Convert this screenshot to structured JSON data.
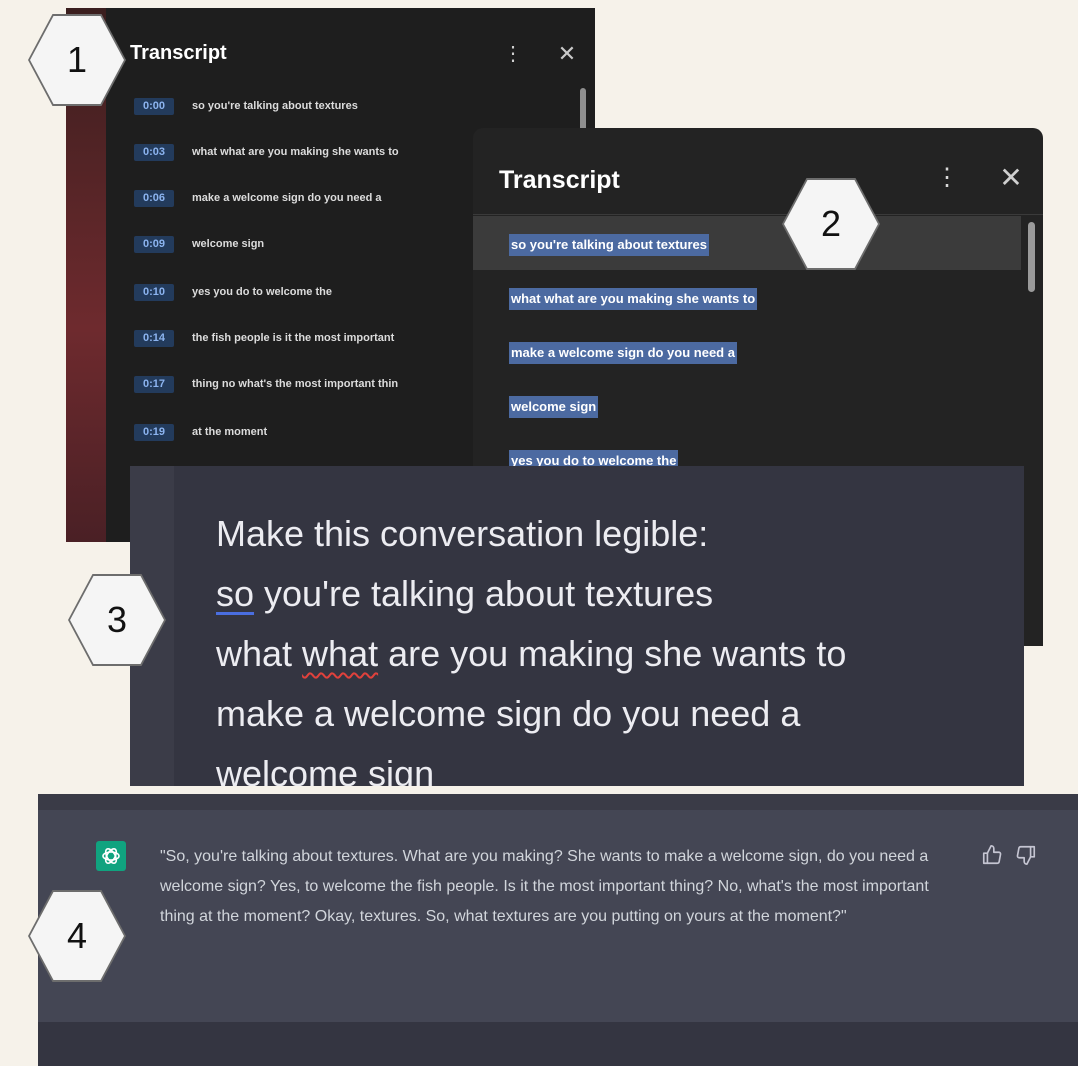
{
  "panel1": {
    "title": "Transcript",
    "rows": [
      {
        "time": "0:00",
        "text": "so you're talking about textures"
      },
      {
        "time": "0:03",
        "text": "what what are you making she wants to"
      },
      {
        "time": "0:06",
        "text": "make a welcome sign do you need a"
      },
      {
        "time": "0:09",
        "text": "welcome sign"
      },
      {
        "time": "0:10",
        "text": "yes you do to welcome the"
      },
      {
        "time": "0:14",
        "text": "the fish people is it the most important"
      },
      {
        "time": "0:17",
        "text": "thing no what's the most important thin"
      },
      {
        "time": "0:19",
        "text": "at the moment"
      }
    ]
  },
  "panel2": {
    "title": "Transcript",
    "lines": [
      "so you're talking about textures",
      "what what are you making she wants to",
      "make a welcome sign do you need a",
      "welcome sign",
      "yes you do to welcome the"
    ]
  },
  "panel3": {
    "line1": "Make this conversation legible:",
    "line2_word": "so",
    "line2_rest": " you're talking about textures",
    "line3_start": "what ",
    "line3_word": "what",
    "line3_rest": " are you making she wants to",
    "line4": "make a welcome sign do you need a",
    "line5": "welcome sign"
  },
  "panel4": {
    "response": "\"So, you're talking about textures. What are you making? She wants to make a welcome sign, do you need a welcome sign? Yes, to welcome the fish people. Is it the most important thing? No, what's the most important thing at the moment? Okay, textures. So, what textures are you putting on yours at the moment?\""
  },
  "badges": [
    "1",
    "2",
    "3",
    "4"
  ],
  "colors": {
    "selection": "#4c6aa1",
    "timestamp_bg": "#233b5c",
    "timestamp_text": "#8cb4f0",
    "chatgpt_green": "#10a37f",
    "prompt_bg": "#343541",
    "response_bg": "#444654"
  },
  "icons": [
    "more-vert-icon",
    "close-icon",
    "chatgpt-logo-icon",
    "thumbs-up-icon",
    "thumbs-down-icon"
  ]
}
